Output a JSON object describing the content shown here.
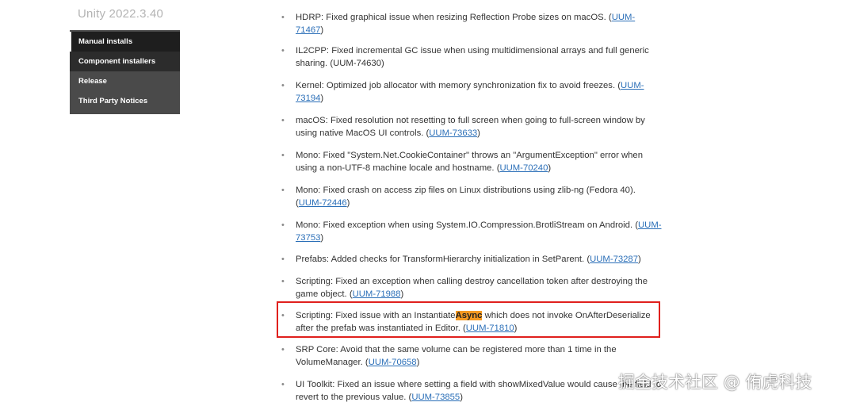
{
  "version_title": "Unity 2022.3.40",
  "side_menu": {
    "items": [
      {
        "label": "Manual installs",
        "active": true
      },
      {
        "label": "Component installers",
        "active": false
      },
      {
        "label": "Release",
        "active": false
      },
      {
        "label": "Third Party Notices",
        "active": false
      }
    ]
  },
  "notes": [
    {
      "text_before": "HDRP: Fixed graphical issue when resizing Reflection Probe sizes on macOS. (",
      "link": "UUM-71467",
      "text_after": ")"
    },
    {
      "text_before": "IL2CPP: Fixed incremental GC issue when using multidimensional arrays and full generic sharing. (UUM-74630)",
      "link": "",
      "text_after": ""
    },
    {
      "text_before": "Kernel: Optimized job allocator with memory synchronization fix to avoid freezes. (",
      "link": "UUM-73194",
      "text_after": ")"
    },
    {
      "text_before": "macOS: Fixed resolution not resetting to full screen when going to full-screen window by using native MacOS UI controls. (",
      "link": "UUM-73633",
      "text_after": ")"
    },
    {
      "text_before": "Mono: Fixed \"System.Net.CookieContainer\" throws an \"ArgumentException\" error when using a non-UTF-8 machine locale and hostname. (",
      "link": "UUM-70240",
      "text_after": ")"
    },
    {
      "text_before": "Mono: Fixed crash on access zip files on Linux distributions using zlib-ng (Fedora 40). (",
      "link": "UUM-72446",
      "text_after": ")"
    },
    {
      "text_before": "Mono: Fixed exception when using System.IO.Compression.BrotliStream on Android. (",
      "link": "UUM-73753",
      "text_after": ")"
    },
    {
      "text_before": "Prefabs: Added checks for TransformHierarchy initialization in SetParent. (",
      "link": "UUM-73287",
      "text_after": ")"
    },
    {
      "text_before": "Scripting: Fixed an exception when calling destroy cancellation token after destroying the game object. (",
      "link": "UUM-71988",
      "text_after": ")"
    },
    {
      "text_before": "Scripting: Fixed issue with an Instantiate",
      "highlight": "Async",
      "text_mid": " which does not invoke OnAfterDeserialize after the prefab was instantiated in Editor. (",
      "link": "UUM-71810",
      "text_after": ")"
    },
    {
      "text_before": "SRP Core: Avoid that the same volume can be registered more than 1 time in the VolumeManager. (",
      "link": "UUM-70658",
      "text_after": ")"
    },
    {
      "text_before": "UI Toolkit: Fixed an issue where setting a field with showMixedValue would cause the field to revert to the previous value. (",
      "link": "UUM-73855",
      "text_after": ")"
    }
  ],
  "bullet_glyph": "•",
  "highlight_color": "#f59a23",
  "frame_color": "#e0201d",
  "link_color": "#2b6fb8",
  "watermark": "掘金技术社区 @ 侑虎科技"
}
